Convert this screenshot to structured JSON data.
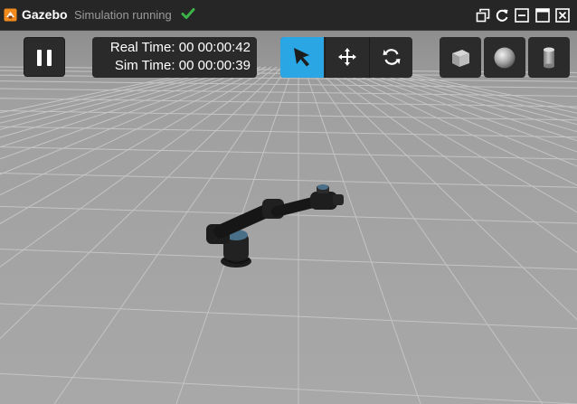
{
  "app": {
    "title": "Gazebo",
    "status": "Simulation running",
    "status_color": "#3bb34a"
  },
  "window_controls": [
    "restore-icon",
    "refresh-icon",
    "minimize-icon",
    "maximize-icon",
    "close-icon"
  ],
  "playback": {
    "state": "running",
    "icon": "pause-icon"
  },
  "time": {
    "real_label": "Real Time:",
    "real_value": "00 00:00:42",
    "sim_label": "Sim Time:",
    "sim_value": "00 00:00:39"
  },
  "tools": [
    {
      "name": "select",
      "icon": "arrow-pointer-icon",
      "active": true
    },
    {
      "name": "translate",
      "icon": "move-arrows-icon",
      "active": false
    },
    {
      "name": "rotate",
      "icon": "rotate-icon",
      "active": false
    }
  ],
  "shapes": [
    {
      "name": "box",
      "icon": "cube-icon"
    },
    {
      "name": "sphere",
      "icon": "sphere-icon"
    },
    {
      "name": "cylinder",
      "icon": "cylinder-icon"
    }
  ],
  "colors": {
    "accent": "#2aa6e5",
    "toolbar_bg": "#2b2b2b",
    "ground": "#a5a5a5",
    "grid_line": "#c4c4c4"
  }
}
